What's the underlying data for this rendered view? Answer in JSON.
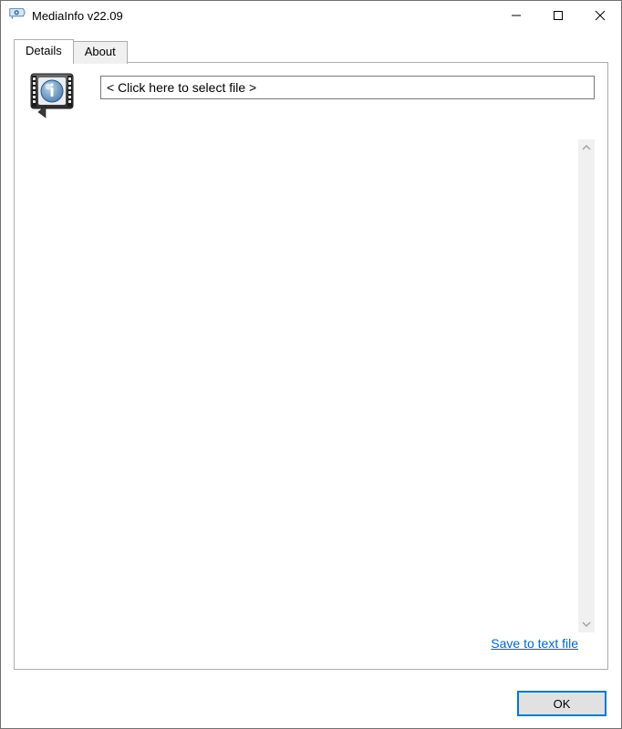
{
  "window": {
    "title": "MediaInfo v22.09"
  },
  "tabs": {
    "details": "Details",
    "about": "About"
  },
  "fileSelect": {
    "placeholder": "< Click here to select file >"
  },
  "saveLink": "Save to text file",
  "okButton": "OK"
}
